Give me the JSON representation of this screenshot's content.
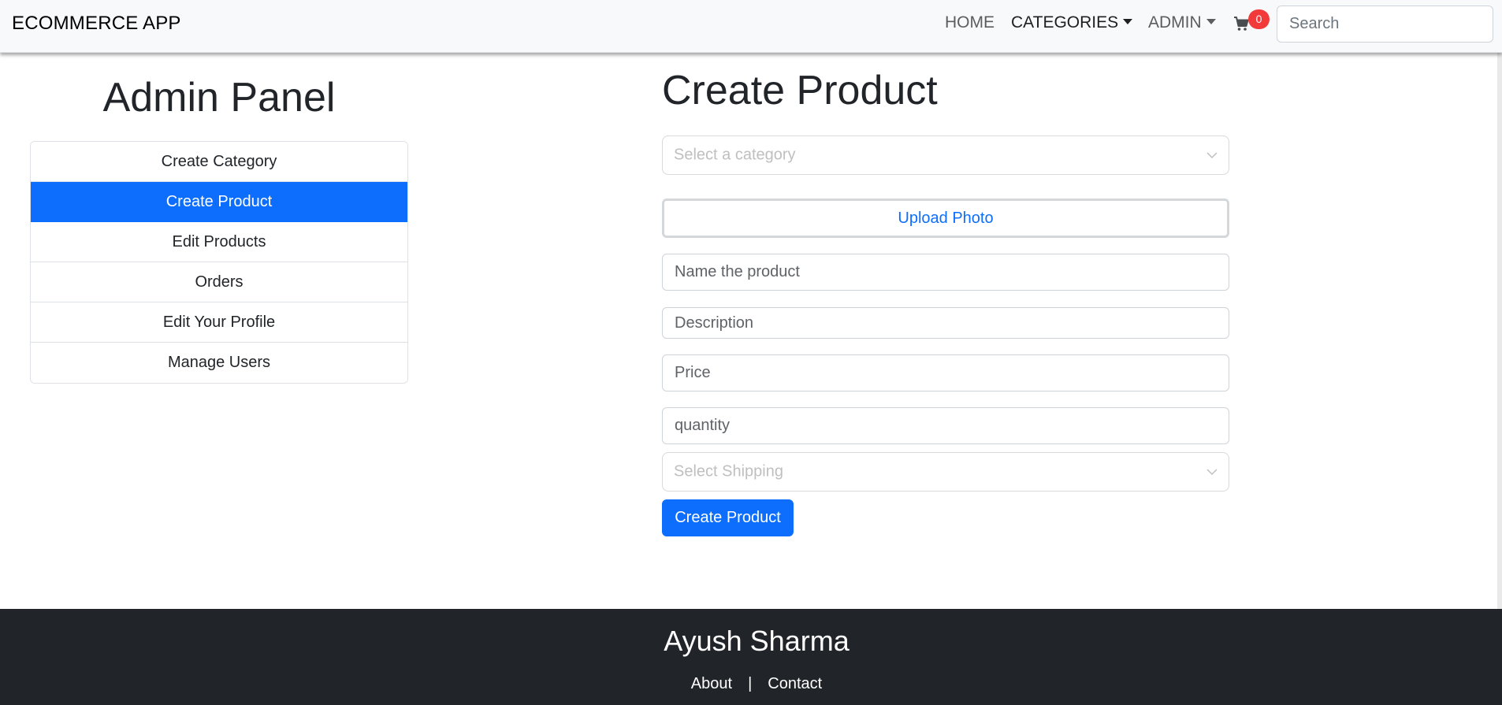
{
  "navbar": {
    "brand": "ECOMMERCE APP",
    "links": {
      "home": "HOME",
      "categories": "CATEGORIES",
      "admin": "ADMIN"
    },
    "cart_count": "0",
    "cart_icon": "cart-icon",
    "search_placeholder": "Search"
  },
  "sidebar": {
    "title": "Admin Panel",
    "items": [
      {
        "label": "Create Category",
        "active": false
      },
      {
        "label": "Create Product",
        "active": true
      },
      {
        "label": "Edit Products",
        "active": false
      },
      {
        "label": "Orders",
        "active": false
      },
      {
        "label": "Edit Your Profile",
        "active": false
      },
      {
        "label": "Manage Users",
        "active": false
      }
    ]
  },
  "form": {
    "title": "Create Product",
    "category_placeholder": "Select a category",
    "upload_label": "Upload Photo",
    "name_placeholder": "Name the product",
    "description_placeholder": "Description",
    "price_placeholder": "Price",
    "quantity_placeholder": "quantity",
    "shipping_placeholder": "Select Shipping",
    "submit_label": "Create Product"
  },
  "footer": {
    "name": "Ayush Sharma",
    "about": "About",
    "separator": "|",
    "contact": "Contact"
  },
  "colors": {
    "primary": "#0d6efd",
    "badge": "#f23a3a",
    "footer_bg": "#212529",
    "navbar_bg": "#f8f9fa"
  }
}
